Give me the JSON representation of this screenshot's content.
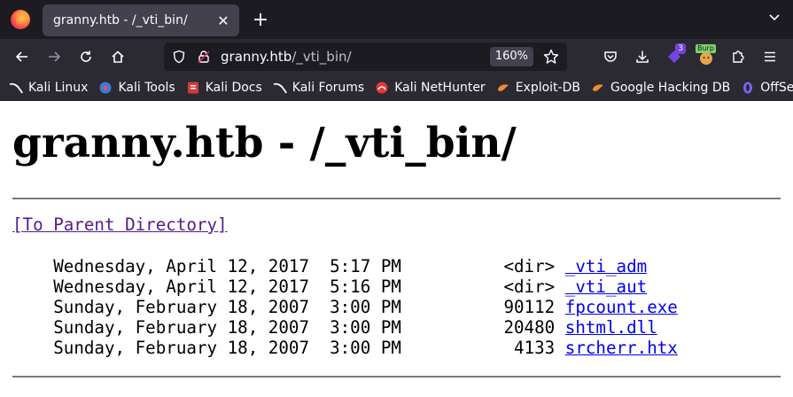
{
  "browser": {
    "tab_title": "granny.htb - /_vti_bin/",
    "tab_close": "✕",
    "new_tab": "+",
    "url_host": "granny.htb",
    "url_path": "/_vti_bin/",
    "zoom": "160%",
    "extension_badge": "3",
    "burp_label": "Burp"
  },
  "bookmarks": [
    {
      "label": "Kali Linux",
      "icon": "kali-dragon-icon"
    },
    {
      "label": "Kali Tools",
      "icon": "kali-tools-icon"
    },
    {
      "label": "Kali Docs",
      "icon": "kali-docs-icon"
    },
    {
      "label": "Kali Forums",
      "icon": "kali-forums-icon"
    },
    {
      "label": "Kali NetHunter",
      "icon": "nethunter-icon"
    },
    {
      "label": "Exploit-DB",
      "icon": "exploitdb-icon"
    },
    {
      "label": "Google Hacking DB",
      "icon": "ghdb-icon"
    },
    {
      "label": "OffSec",
      "icon": "offsec-icon"
    }
  ],
  "page": {
    "heading": "granny.htb - /_vti_bin/",
    "parent_link": "[To Parent Directory]",
    "entries": [
      {
        "date": "Wednesday, April 12, 2017",
        "time": "5:17 PM",
        "size": "<dir>",
        "name": "_vti_adm"
      },
      {
        "date": "Wednesday, April 12, 2017",
        "time": "5:16 PM",
        "size": "<dir>",
        "name": "_vti_aut"
      },
      {
        "date": "Sunday, February 18, 2007",
        "time": "3:00 PM",
        "size": "90112",
        "name": "fpcount.exe"
      },
      {
        "date": "Sunday, February 18, 2007",
        "time": "3:00 PM",
        "size": "20480",
        "name": "shtml.dll"
      },
      {
        "date": "Sunday, February 18, 2007",
        "time": "3:00 PM",
        "size": "4133",
        "name": "srcherr.htx"
      }
    ]
  }
}
